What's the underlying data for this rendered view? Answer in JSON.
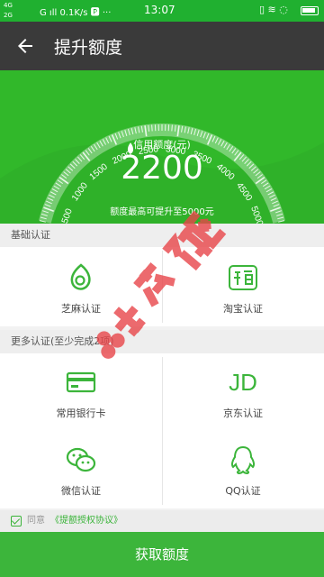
{
  "status_bar": {
    "signal_top": "4G",
    "signal_bottom": "2G",
    "network": "G ıll 0.1K/s 🅿 ···",
    "time": "13:07",
    "right_icons": "▯ ≋ ◌"
  },
  "appbar": {
    "title": "提升额度"
  },
  "gauge": {
    "ticks": [
      "500",
      "1000",
      "1500",
      "2000",
      "2500",
      "3000",
      "3500",
      "4000",
      "4500",
      "5000"
    ],
    "credit_label": "信用额度(元)",
    "credit_value": "2200",
    "max_text": "额度最高可提升至5000元",
    "min": 500,
    "max": 5000,
    "current": 2200
  },
  "basic": {
    "header": "基础认证",
    "items": [
      {
        "label": "芝麻认证",
        "icon": "sesame-icon"
      },
      {
        "label": "淘宝认证",
        "icon": "taobao-icon"
      }
    ]
  },
  "more": {
    "header": "更多认证(至少完成2项)",
    "items": [
      {
        "label": "常用银行卡",
        "icon": "bank-card-icon"
      },
      {
        "label": "京东认证",
        "icon": "jd-icon",
        "glyph": "JD"
      },
      {
        "label": "微信认证",
        "icon": "wechat-icon"
      },
      {
        "label": "QQ认证",
        "icon": "qq-icon"
      }
    ]
  },
  "agreement": {
    "prefix": "同意",
    "link": "《提额授权协议》"
  },
  "submit_label": "获取额度",
  "watermark": "卡农社区",
  "colors": {
    "primary_green": "#3cb53b",
    "appbar": "#3a3a3a",
    "watermark_red": "#e8464a"
  }
}
